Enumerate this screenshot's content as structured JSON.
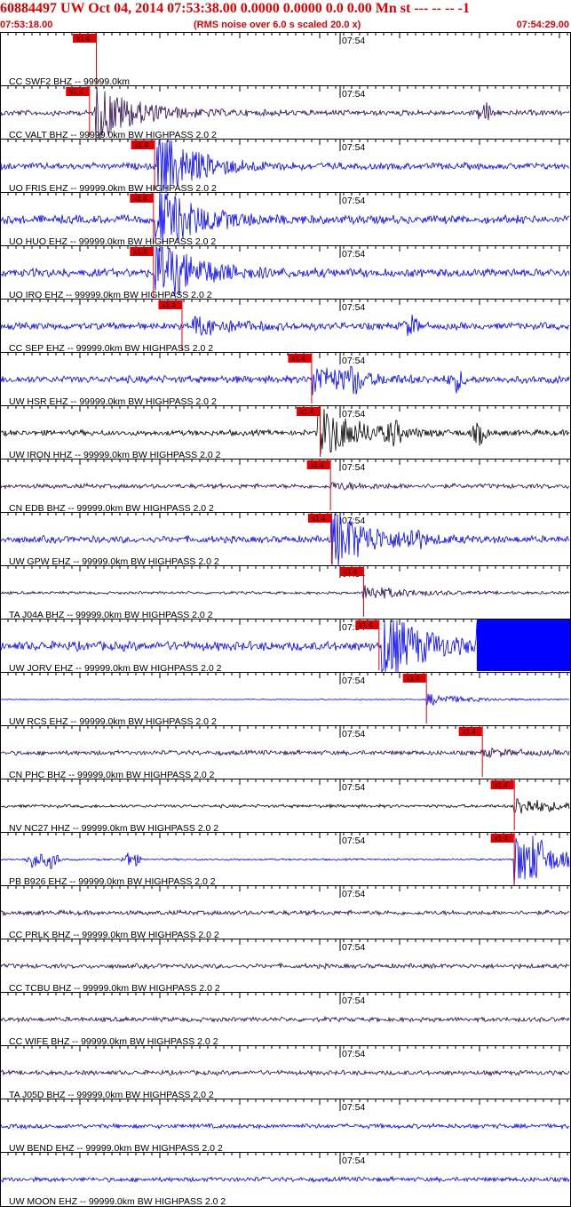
{
  "header": {
    "title": "60884497 UW Oct 04, 2014 07:53:38.00    0.0000    0.0000  0.0 0.00 Mn st --- -- --   -1",
    "start_time": "07:53:18.00",
    "scale_note": "(RMS noise over 6.0 s scaled 20.0 x)",
    "end_time": "07:54:29.00"
  },
  "time_marker_label": "07:54",
  "pick_label": "x1.4",
  "colors": {
    "border": "#000000",
    "pick": "#e00000",
    "blue": "#0000ff",
    "dark": "#2a0a50",
    "black": "#000000"
  },
  "traces": [
    {
      "label": "CC SWF2 BHZ -- 99999.0km",
      "color": "none",
      "pick": 0.168,
      "event": 0.168,
      "amp": 0,
      "noise": 0.0
    },
    {
      "label": "CC VALT BHZ -- 99999.0km BW  HIGHPASS  2.0  2",
      "color": "dark",
      "pick": 0.156,
      "event": 0.165,
      "amp": 1.0,
      "noise": 0.12,
      "later": [
        0.85
      ]
    },
    {
      "label": "UO FRIS EHZ -- 99999.0km BW  HIGHPASS  2.0  2",
      "color": "blue",
      "pick": 0.27,
      "event": 0.275,
      "amp": 1.1,
      "noise": 0.14
    },
    {
      "label": "UO HUO EHZ -- 99999.0km BW  HIGHPASS  2.0  2",
      "color": "blue",
      "pick": 0.268,
      "event": 0.272,
      "amp": 1.1,
      "noise": 0.18
    },
    {
      "label": "UO IRO EHZ -- 99999.0km BW  HIGHPASS  2.0  2",
      "color": "blue",
      "pick": 0.268,
      "event": 0.272,
      "amp": 1.1,
      "noise": 0.18
    },
    {
      "label": "CC SEP EHZ -- 99999.0km BW  HIGHPASS  2.0  2",
      "color": "blue",
      "pick": 0.318,
      "event": 0.335,
      "amp": 0.3,
      "noise": 0.15,
      "later": [
        0.72
      ]
    },
    {
      "label": "UW HSR EHZ -- 99999.0km BW  HIGHPASS  2.0  2",
      "color": "blue",
      "pick": 0.545,
      "event": 0.545,
      "amp": 0.5,
      "noise": 0.16,
      "later": [
        0.62,
        0.8
      ]
    },
    {
      "label": "UW IRON HHZ -- 99999.0km BW  HIGHPASS  2.0  2",
      "color": "black",
      "pick": 0.56,
      "event": 0.556,
      "amp": 0.9,
      "noise": 0.12,
      "later": [
        0.69,
        0.84
      ]
    },
    {
      "label": "CN EDB BHZ -- 99999.0km BW  HIGHPASS  2.0  2",
      "color": "dark",
      "pick": 0.578,
      "event": 0.578,
      "amp": 0.1,
      "noise": 0.1
    },
    {
      "label": "UW GPW EHZ -- 99999.0km BW  HIGHPASS  2.0  2",
      "color": "blue",
      "pick": 0.58,
      "event": 0.58,
      "amp": 1.0,
      "noise": 0.15,
      "later": [
        0.725
      ]
    },
    {
      "label": "TA J04A BHZ -- 99999.0km BW  HIGHPASS  2.0  2",
      "color": "dark",
      "pick": 0.636,
      "event": 0.636,
      "amp": 0.25,
      "noise": 0.06
    },
    {
      "label": "UW JORV EHZ -- 99999.0km BW  HIGHPASS  2.0  2",
      "color": "blue",
      "pick": 0.663,
      "event": 0.668,
      "amp": 1.2,
      "noise": 0.2,
      "clip": 0.835
    },
    {
      "label": "UW RCS EHZ -- 99999.0km BW  HIGHPASS  2.0  2",
      "color": "blue",
      "pick": 0.746,
      "event": 0.746,
      "amp": 0.2,
      "noise": 0.02
    },
    {
      "label": "CN PHC BHZ -- 99999.0km BW  HIGHPASS  2.0  2",
      "color": "dark",
      "pick": 0.844,
      "event": 0.844,
      "amp": 0.1,
      "noise": 0.1
    },
    {
      "label": "NV NC27 HHZ -- 99999.0km BW  HIGHPASS  2.0  2",
      "color": "black",
      "pick": 0.9,
      "event": 0.9,
      "amp": 0.3,
      "noise": 0.07
    },
    {
      "label": "PB B926 EHZ -- 99999.0km BW  HIGHPASS  2.0  2",
      "color": "blue",
      "pick": 0.9,
      "event": 0.9,
      "amp": 0.9,
      "noise": 0.04,
      "later": [
        0.06,
        0.09,
        0.23,
        0.94
      ]
    },
    {
      "label": "CC PRLK BHZ -- 99999.0km BW  HIGHPASS  2.0  2",
      "color": "dark",
      "pick": null,
      "event": null,
      "amp": 0,
      "noise": 0.1
    },
    {
      "label": "CC TCBU BHZ -- 99999.0km BW  HIGHPASS  2.0  2",
      "color": "dark",
      "pick": null,
      "event": null,
      "amp": 0,
      "noise": 0.1
    },
    {
      "label": "CC WIFE BHZ -- 99999.0km BW  HIGHPASS  2.0  2",
      "color": "dark",
      "pick": null,
      "event": null,
      "amp": 0,
      "noise": 0.1
    },
    {
      "label": "TA J05D BHZ -- 99999.0km BW  HIGHPASS  2.0  2",
      "color": "dark",
      "pick": null,
      "event": null,
      "amp": 0,
      "noise": 0.1
    },
    {
      "label": "UW BEND EHZ -- 99999.0km BW  HIGHPASS  2.0  2",
      "color": "blue",
      "pick": null,
      "event": null,
      "amp": 0,
      "noise": 0.1
    },
    {
      "label": "UW MOON EHZ -- 99999.0km BW  HIGHPASS  2.0  2",
      "color": "blue",
      "pick": null,
      "event": null,
      "amp": 0,
      "noise": 0.1
    }
  ]
}
